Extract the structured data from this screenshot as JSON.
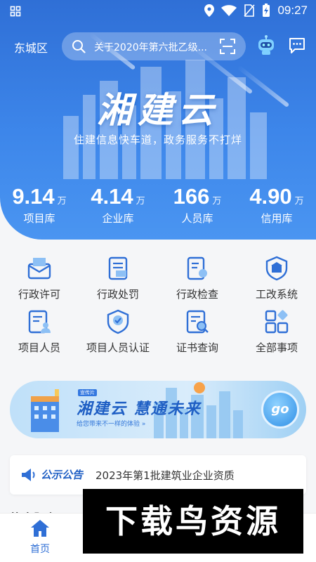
{
  "status_bar": {
    "time": "09:27"
  },
  "topbar": {
    "city": "东城区",
    "search_text": "关于2020年第六批乙级...",
    "icons": [
      "search-icon",
      "scan-icon",
      "robot-icon",
      "message-icon"
    ]
  },
  "brand": {
    "name": "湘建云",
    "slogan": "住建信息快车道，政务服务不打烊"
  },
  "stats": [
    {
      "value": "9.14",
      "unit": "万",
      "label": "项目库"
    },
    {
      "value": "4.14",
      "unit": "万",
      "label": "企业库"
    },
    {
      "value": "166",
      "unit": "万",
      "label": "人员库"
    },
    {
      "value": "4.90",
      "unit": "万",
      "label": "信用库"
    }
  ],
  "features": [
    {
      "label": "行政许可",
      "icon": "permit-icon"
    },
    {
      "label": "行政处罚",
      "icon": "penalty-icon"
    },
    {
      "label": "行政检查",
      "icon": "inspection-icon"
    },
    {
      "label": "工改系统",
      "icon": "reform-system-icon"
    },
    {
      "label": "项目人员",
      "icon": "project-staff-icon"
    },
    {
      "label": "项目人员认证",
      "icon": "staff-certification-icon"
    },
    {
      "label": "证书查询",
      "icon": "certificate-search-icon"
    },
    {
      "label": "全部事项",
      "icon": "all-items-icon"
    }
  ],
  "banner": {
    "tag": "宣传片",
    "title": "湘建云  慧通未来",
    "subtitle": "给您带来不一样的体验 »",
    "go_label": "go"
  },
  "notice": {
    "tag": "公示公告",
    "text": "2023年第1批建筑业企业资质"
  },
  "section_peek": "热点服务",
  "tabbar": {
    "home_label": "首页"
  },
  "watermark": "下载鸟资源",
  "colors": {
    "primary": "#2f6fd6",
    "hero_end": "#4a95f1",
    "background": "#f5f6f8"
  }
}
